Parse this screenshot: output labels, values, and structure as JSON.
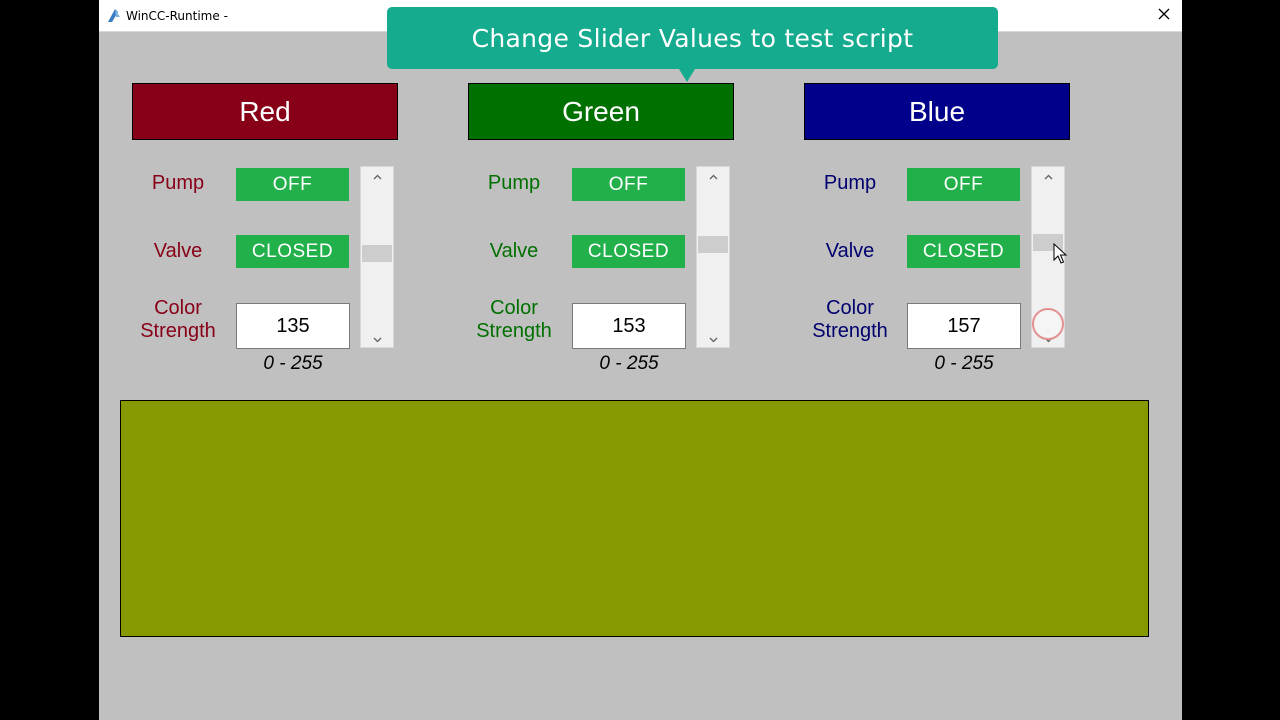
{
  "window": {
    "title": "WinCC-Runtime -"
  },
  "tooltip": {
    "text": "Change Slider Values to test script"
  },
  "labels": {
    "pump": "Pump",
    "valve": "Valve",
    "color_line1": "Color",
    "color_line2": "Strength",
    "range": "0 - 255"
  },
  "channels": [
    {
      "name": "Red",
      "header_color": "#880018",
      "label_color": "#880018",
      "pump_status": "OFF",
      "valve_status": "CLOSED",
      "color_strength": "135",
      "slider_value": 135
    },
    {
      "name": "Green",
      "header_color": "#007000",
      "label_color": "#007000",
      "pump_status": "OFF",
      "valve_status": "CLOSED",
      "color_strength": "153",
      "slider_value": 153
    },
    {
      "name": "Blue",
      "header_color": "#00008a",
      "label_color": "#00006e",
      "pump_status": "OFF",
      "valve_status": "CLOSED",
      "color_strength": "157",
      "slider_value": 157
    }
  ],
  "colors": {
    "status_on_button": "#22b04b",
    "window_bg": "#c0c0c0",
    "mixed_color_panel": "#879900",
    "tooltip_bg": "#14ab8e"
  },
  "icons": {
    "app": "wincc-app-icon",
    "close": "close-icon",
    "scroll_up": "chevron-up-icon",
    "scroll_down": "chevron-down-icon",
    "cursor": "mouse-pointer-icon"
  }
}
